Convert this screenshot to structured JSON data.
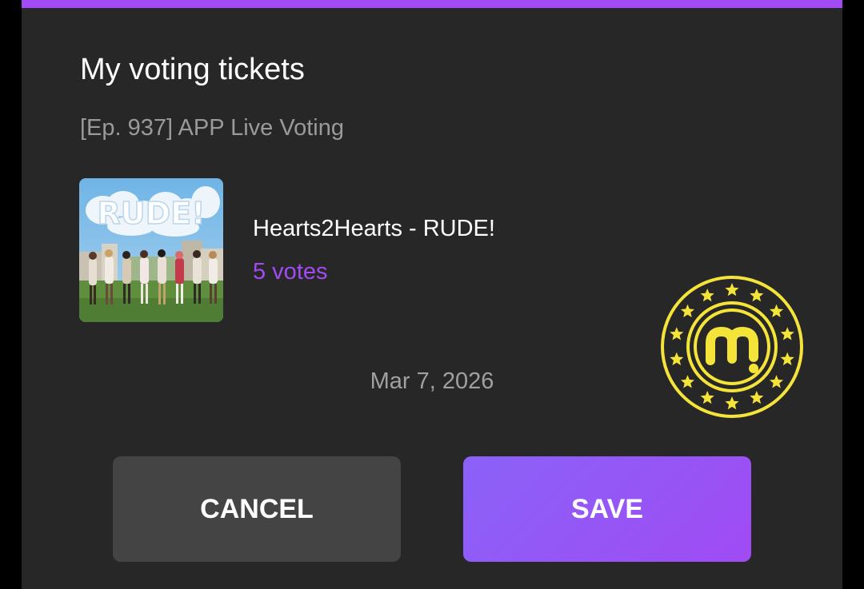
{
  "dialog": {
    "title": "My voting tickets",
    "subtitle": "[Ep. 937] APP Live Voting",
    "accent_color": "#a24bf5"
  },
  "ticket": {
    "album_cover_text": "RUDE!",
    "song": "Hearts2Hearts - RUDE!",
    "votes": "5 votes",
    "date": "Mar 7, 2026",
    "stamp_icon": "m-star-badge-icon",
    "stamp_color": "#f4e43a"
  },
  "buttons": {
    "cancel_label": "CANCEL",
    "save_label": "SAVE"
  }
}
